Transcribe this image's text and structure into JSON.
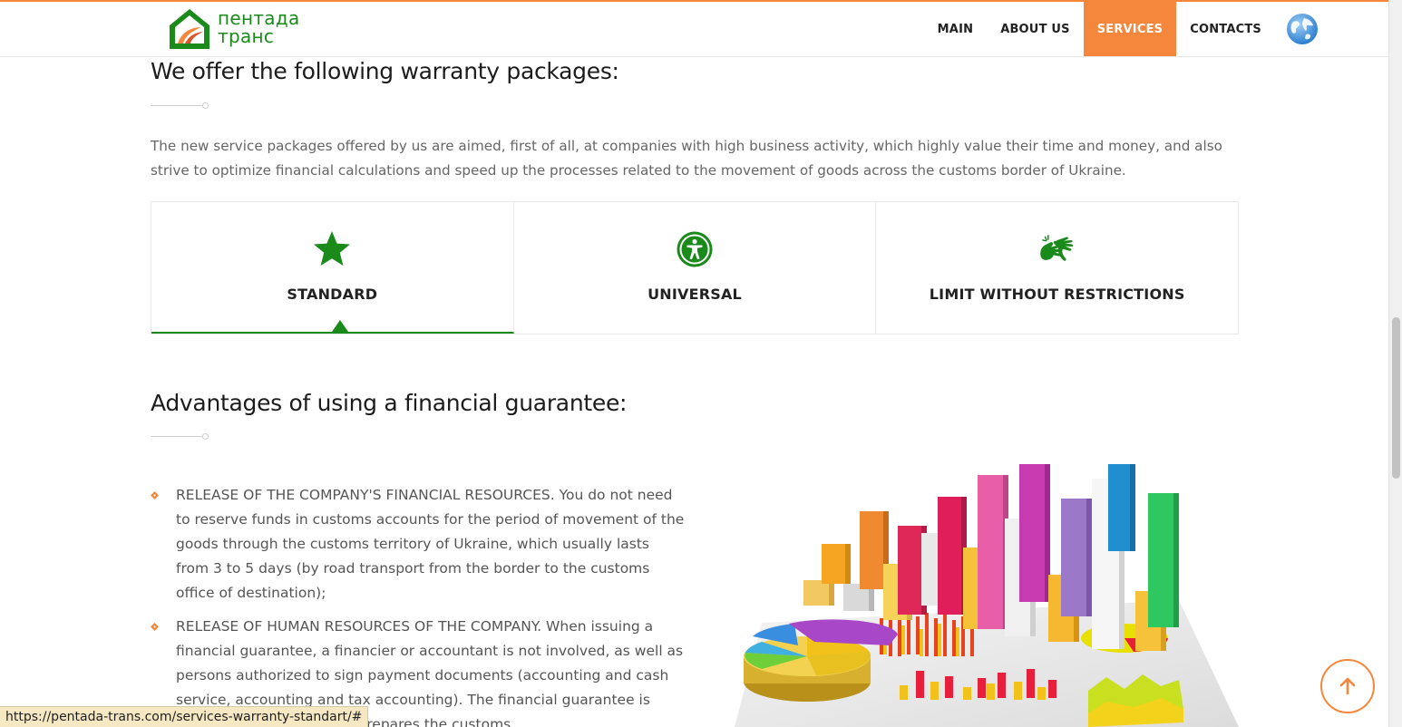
{
  "header": {
    "logo_text_line1": "пентада",
    "logo_text_line2": "транс",
    "nav": [
      {
        "label": "MAIN"
      },
      {
        "label": "ABOUT US"
      },
      {
        "label": "SERVICES",
        "active": true
      },
      {
        "label": "CONTACTS"
      }
    ],
    "globe_icon": "globe-icon"
  },
  "packages": {
    "title": "We offer the following warranty packages:",
    "intro": "The new service packages offered by us are aimed, first of all, at companies with high business activity, which highly value their time and money, and also strive to optimize financial calculations and speed up the processes related to the movement of goods across the customs border of Ukraine.",
    "tabs": [
      {
        "label": "STANDARD",
        "icon": "star-icon",
        "active": true
      },
      {
        "label": "UNIVERSAL",
        "icon": "accessibility-icon"
      },
      {
        "label": "LIMIT WITHOUT RESTRICTIONS",
        "icon": "sign-language-icon"
      }
    ]
  },
  "advantages": {
    "title": "Advantages of using a financial guarantee:",
    "items": [
      "RELEASE OF THE COMPANY'S FINANCIAL RESOURCES. You do not need to reserve funds in customs accounts for the period of movement of the goods through the customs territory of Ukraine, which usually lasts from 3 to 5 days (by road transport from the border to the customs office of destination);",
      "RELEASE OF HUMAN RESOURCES OF THE COMPANY. When issuing a financial guarantee, a financier or accountant is not involved, as well as persons authorized to sign payment documents (accounting and cash service, accounting and tax accounting). The financial guarantee is issued by the broker who prepares the customs"
    ]
  },
  "status_url": "https://pentada-trans.com/services-warranty-standart/#",
  "colors": {
    "accent_orange": "#f5873d",
    "brand_green": "#1a8a1a"
  }
}
